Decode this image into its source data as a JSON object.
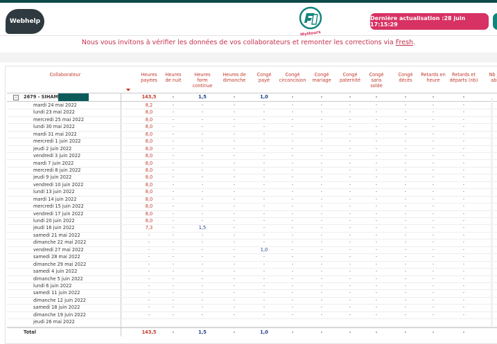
{
  "header": {
    "brand_left": "Webhelp",
    "brand_center": "MyHours",
    "last_update": "Dernière actualisation :28 juin 17:15:29"
  },
  "banner": {
    "text_before": "Nous vous invitons à vérifier les données de vos collaborateurs et remonter les corrections via ",
    "link": "Fresh",
    "text_after": "."
  },
  "table": {
    "columns": [
      {
        "key": "collab",
        "label": "Collaborateur"
      },
      {
        "key": "hp",
        "label": "Heures payées"
      },
      {
        "key": "hn",
        "label": "Heures de nuit"
      },
      {
        "key": "hf",
        "label": "Heures form continue"
      },
      {
        "key": "hd",
        "label": "Heures de dimanche"
      },
      {
        "key": "cp",
        "label": "Congé payé"
      },
      {
        "key": "cc",
        "label": "Congé circoncision"
      },
      {
        "key": "cm",
        "label": "Congé mariage"
      },
      {
        "key": "cpat",
        "label": "Congé paternité"
      },
      {
        "key": "css",
        "label": "Congé sans solde"
      },
      {
        "key": "cd",
        "label": "Congé décès"
      },
      {
        "key": "rh",
        "label": "Retards en heure"
      },
      {
        "key": "rd",
        "label": "Retards et départs (nb)"
      },
      {
        "key": "nb",
        "label": "Nb jo abs"
      }
    ],
    "group": {
      "label": "2679 - SIHAM",
      "expander": "−",
      "values": [
        "143,5",
        "-",
        "1,5",
        "-",
        "1,0",
        "-",
        "-",
        "-",
        "-",
        "-",
        "-",
        "-"
      ]
    },
    "rows": [
      {
        "label": "mardi 24 mai 2022",
        "hp": "8,2",
        "hf": "-",
        "cp": "-"
      },
      {
        "label": "lundi 23 mai 2022",
        "hp": "8,0",
        "hf": "-",
        "cp": "-"
      },
      {
        "label": "mercredi 25 mai 2022",
        "hp": "8,0",
        "hf": "-",
        "cp": "-"
      },
      {
        "label": "lundi 30 mai 2022",
        "hp": "8,0",
        "hf": "-",
        "cp": "-"
      },
      {
        "label": "mardi 31 mai 2022",
        "hp": "8,0",
        "hf": "-",
        "cp": "-"
      },
      {
        "label": "mercredi 1 juin 2022",
        "hp": "8,0",
        "hf": "-",
        "cp": "-"
      },
      {
        "label": "jeudi 2 juin 2022",
        "hp": "8,0",
        "hf": "-",
        "cp": "-"
      },
      {
        "label": "vendredi 3 juin 2022",
        "hp": "8,0",
        "hf": "-",
        "cp": "-"
      },
      {
        "label": "mardi 7 juin 2022",
        "hp": "8,0",
        "hf": "-",
        "cp": "-"
      },
      {
        "label": "mercredi 8 juin 2022",
        "hp": "8,0",
        "hf": "-",
        "cp": "-"
      },
      {
        "label": "jeudi 9 juin 2022",
        "hp": "8,0",
        "hf": "-",
        "cp": "-"
      },
      {
        "label": "vendredi 10 juin 2022",
        "hp": "8,0",
        "hf": "-",
        "cp": "-"
      },
      {
        "label": "lundi 13 juin 2022",
        "hp": "8,0",
        "hf": "-",
        "cp": "-"
      },
      {
        "label": "mardi 14 juin 2022",
        "hp": "8,0",
        "hf": "-",
        "cp": "-"
      },
      {
        "label": "mercredi 15 juin 2022",
        "hp": "8,0",
        "hf": "-",
        "cp": "-"
      },
      {
        "label": "vendredi 17 juin 2022",
        "hp": "8,0",
        "hf": "-",
        "cp": "-"
      },
      {
        "label": "lundi 20 juin 2022",
        "hp": "8,0",
        "hf": "-",
        "cp": "-"
      },
      {
        "label": "jeudi 16 juin 2022",
        "hp": "7,3",
        "hf": "1,5",
        "cp": "-"
      },
      {
        "label": "samedi 21 mai 2022",
        "hp": "-",
        "hf": "-",
        "cp": "-"
      },
      {
        "label": "dimanche 22 mai 2022",
        "hp": "-",
        "hf": "-",
        "cp": "-"
      },
      {
        "label": "vendredi 27 mai 2022",
        "hp": "-",
        "hf": "-",
        "cp": "1,0"
      },
      {
        "label": "samedi 28 mai 2022",
        "hp": "-",
        "hf": "-",
        "cp": "-"
      },
      {
        "label": "dimanche 29 mai 2022",
        "hp": "-",
        "hf": "-",
        "cp": "-"
      },
      {
        "label": "samedi 4 juin 2022",
        "hp": "-",
        "hf": "-",
        "cp": "-"
      },
      {
        "label": "dimanche 5 juin 2022",
        "hp": "-",
        "hf": "-",
        "cp": "-"
      },
      {
        "label": "lundi 6 juin 2022",
        "hp": "-",
        "hf": "-",
        "cp": "-"
      },
      {
        "label": "samedi 11 juin 2022",
        "hp": "-",
        "hf": "-",
        "cp": "-"
      },
      {
        "label": "dimanche 12 juin 2022",
        "hp": "-",
        "hf": "-",
        "cp": "-"
      },
      {
        "label": "samedi 18 juin 2022",
        "hp": "-",
        "hf": "-",
        "cp": "-"
      },
      {
        "label": "dimanche 19 juin 2022",
        "hp": "-",
        "hf": "-",
        "cp": "-"
      },
      {
        "label": "jeudi 26 mai 2022",
        "hp": "",
        "hf": "",
        "cp": ""
      }
    ],
    "total": {
      "label": "Total",
      "values": [
        "143,5",
        "-",
        "1,5",
        "-",
        "1,0",
        "-",
        "-",
        "-",
        "-",
        "-",
        "-",
        "-"
      ]
    },
    "empty_cell": "-"
  },
  "colors": {
    "accent": "#d73263",
    "dark_teal": "#0c5b5b",
    "header_text": "#c0392b",
    "blue_value": "#1d3f8e"
  }
}
